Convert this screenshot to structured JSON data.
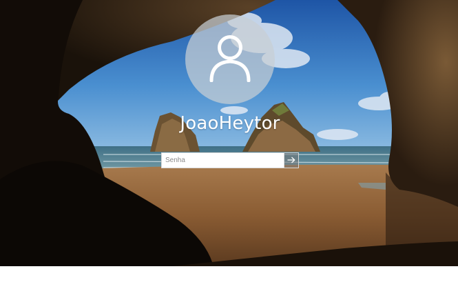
{
  "lock_screen": {
    "user": {
      "avatar_icon": "user-silhouette-icon",
      "name": "JoaoHeytor"
    },
    "password": {
      "placeholder": "Senha",
      "value": "",
      "submit_icon": "arrow-right-icon"
    }
  },
  "colors": {
    "avatar_fill": "#c8ced4",
    "text": "#ffffff",
    "cave": "#0d0a07",
    "sky": "#2f6fb8",
    "sand": "#9b6a3c"
  }
}
